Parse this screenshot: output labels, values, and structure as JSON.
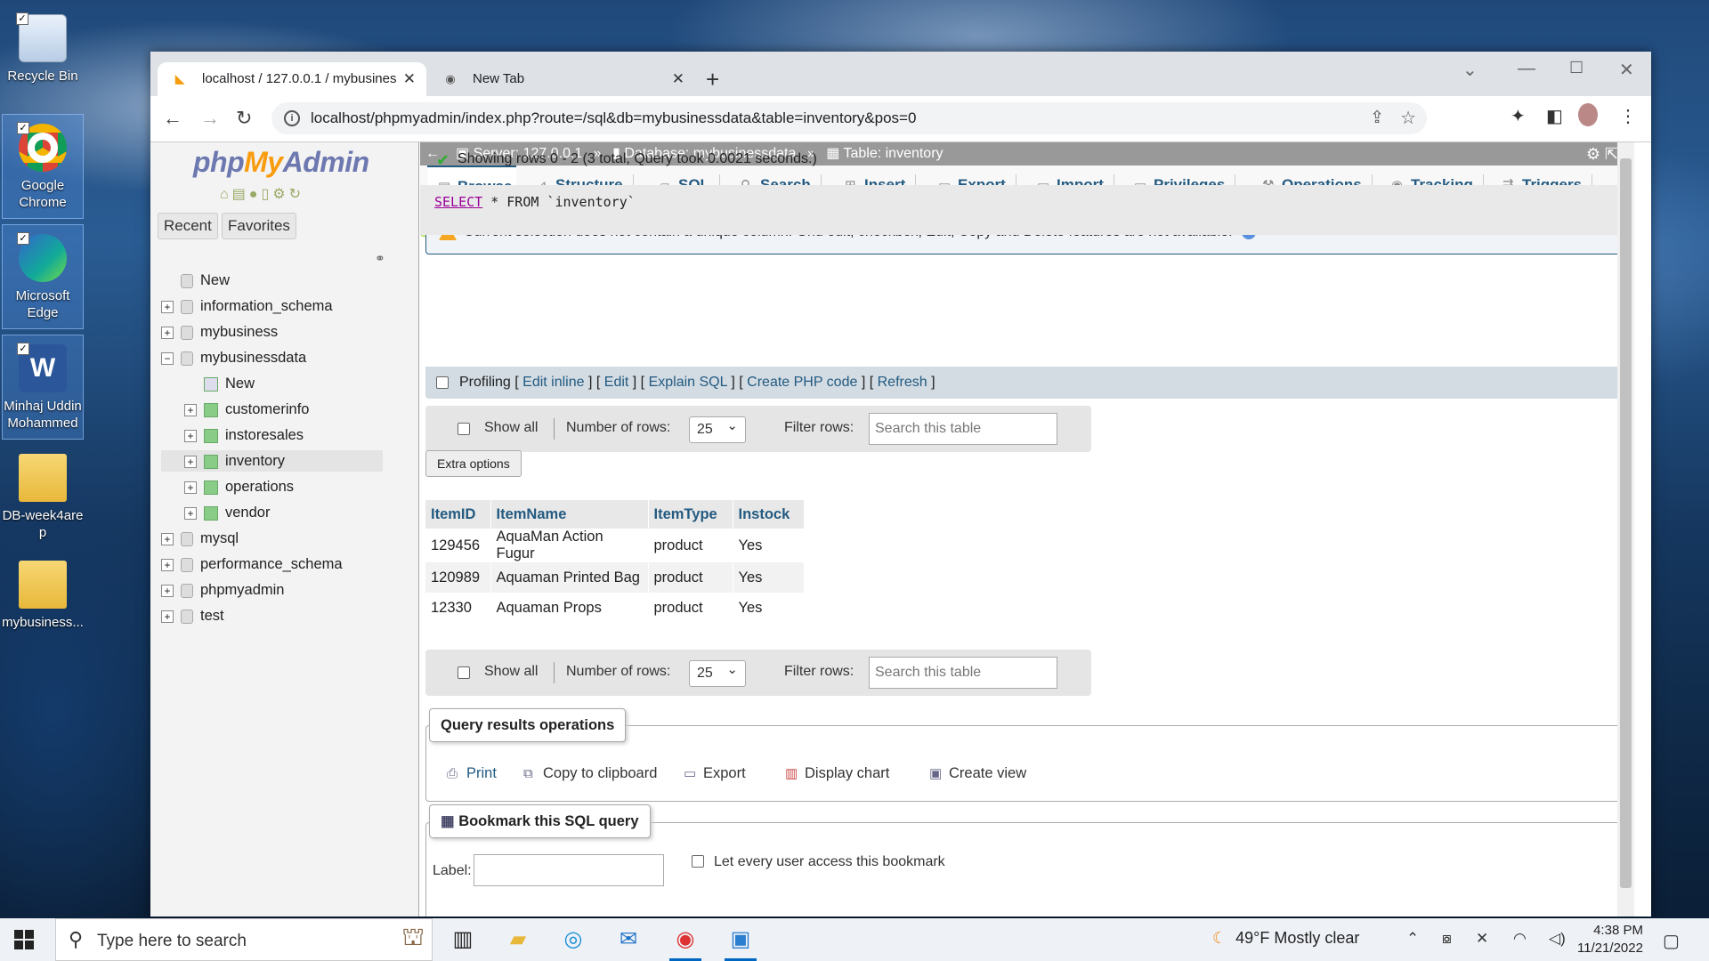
{
  "desktop": {
    "icons": [
      {
        "label": "Recycle Bin"
      },
      {
        "label": "Google Chrome"
      },
      {
        "label": "Microsoft Edge"
      },
      {
        "label": "Minhaj Uddin Mohammed"
      },
      {
        "label": "DB-week4are p"
      },
      {
        "label": "mybusiness..."
      }
    ]
  },
  "browser": {
    "tabs": [
      {
        "title": "localhost / 127.0.0.1 / mybusines"
      },
      {
        "title": "New Tab"
      }
    ],
    "url": "localhost/phpmyadmin/index.php?route=/sql&db=mybusinessdata&table=inventory&pos=0"
  },
  "pma": {
    "logo_php": "php",
    "logo_my": "My",
    "logo_admin": "Admin",
    "nav_buttons": {
      "recent": "Recent",
      "favorites": "Favorites"
    },
    "tree": [
      {
        "label": "New",
        "level": 0
      },
      {
        "label": "information_schema",
        "level": 0
      },
      {
        "label": "mybusiness",
        "level": 0
      },
      {
        "label": "mybusinessdata",
        "level": 0
      },
      {
        "label": "New",
        "level": 1
      },
      {
        "label": "customerinfo",
        "level": 1
      },
      {
        "label": "instoresales",
        "level": 1
      },
      {
        "label": "inventory",
        "level": 1
      },
      {
        "label": "operations",
        "level": 1
      },
      {
        "label": "vendor",
        "level": 1
      },
      {
        "label": "mysql",
        "level": 0
      },
      {
        "label": "performance_schema",
        "level": 0
      },
      {
        "label": "phpmyadmin",
        "level": 0
      },
      {
        "label": "test",
        "level": 0
      }
    ],
    "breadcrumb": {
      "server": "Server: 127.0.0.1",
      "database": "Database: mybusinessdata",
      "table": "Table: inventory",
      "sep": "»"
    },
    "tabs": [
      "Browse",
      "Structure",
      "SQL",
      "Search",
      "Insert",
      "Export",
      "Import",
      "Privileges",
      "Operations",
      "Tracking",
      "Triggers"
    ],
    "notice": "Current selection does not contain a unique column. Grid edit, checkbox, Edit, Copy and Delete features are not available.",
    "success": "Showing rows 0 - 2 (3 total, Query took 0.0021 seconds.)",
    "sql": {
      "select": "SELECT",
      "rest": " * FROM `inventory`"
    },
    "profiling": {
      "label": "Profiling",
      "edit_inline": "Edit inline",
      "edit": "Edit",
      "explain": "Explain SQL",
      "php": "Create PHP code",
      "refresh": "Refresh"
    },
    "nav_rows": {
      "show_all": "Show all",
      "num_rows_label": "Number of rows:",
      "num_rows": "25",
      "filter_label": "Filter rows:",
      "filter_placeholder": "Search this table"
    },
    "extra_options": "Extra options",
    "table": {
      "headers": [
        "ItemID",
        "ItemName",
        "ItemType",
        "Instock"
      ],
      "rows": [
        [
          "129456",
          "AquaMan Action Fugur",
          "product",
          "Yes"
        ],
        [
          "120989",
          "Aquaman Printed Bag",
          "product",
          "Yes"
        ],
        [
          "12330",
          "Aquaman Props",
          "product",
          "Yes"
        ]
      ]
    },
    "query_ops": {
      "legend": "Query results operations",
      "print": "Print",
      "copy": "Copy to clipboard",
      "export": "Export",
      "chart": "Display chart",
      "view": "Create view"
    },
    "bookmark": {
      "legend": "Bookmark this SQL query",
      "label": "Label:",
      "share": "Let every user access this bookmark"
    }
  },
  "taskbar": {
    "search_placeholder": "Type here to search",
    "weather": "49°F  Mostly clear",
    "time": "4:38 PM",
    "date": "11/21/2022"
  }
}
